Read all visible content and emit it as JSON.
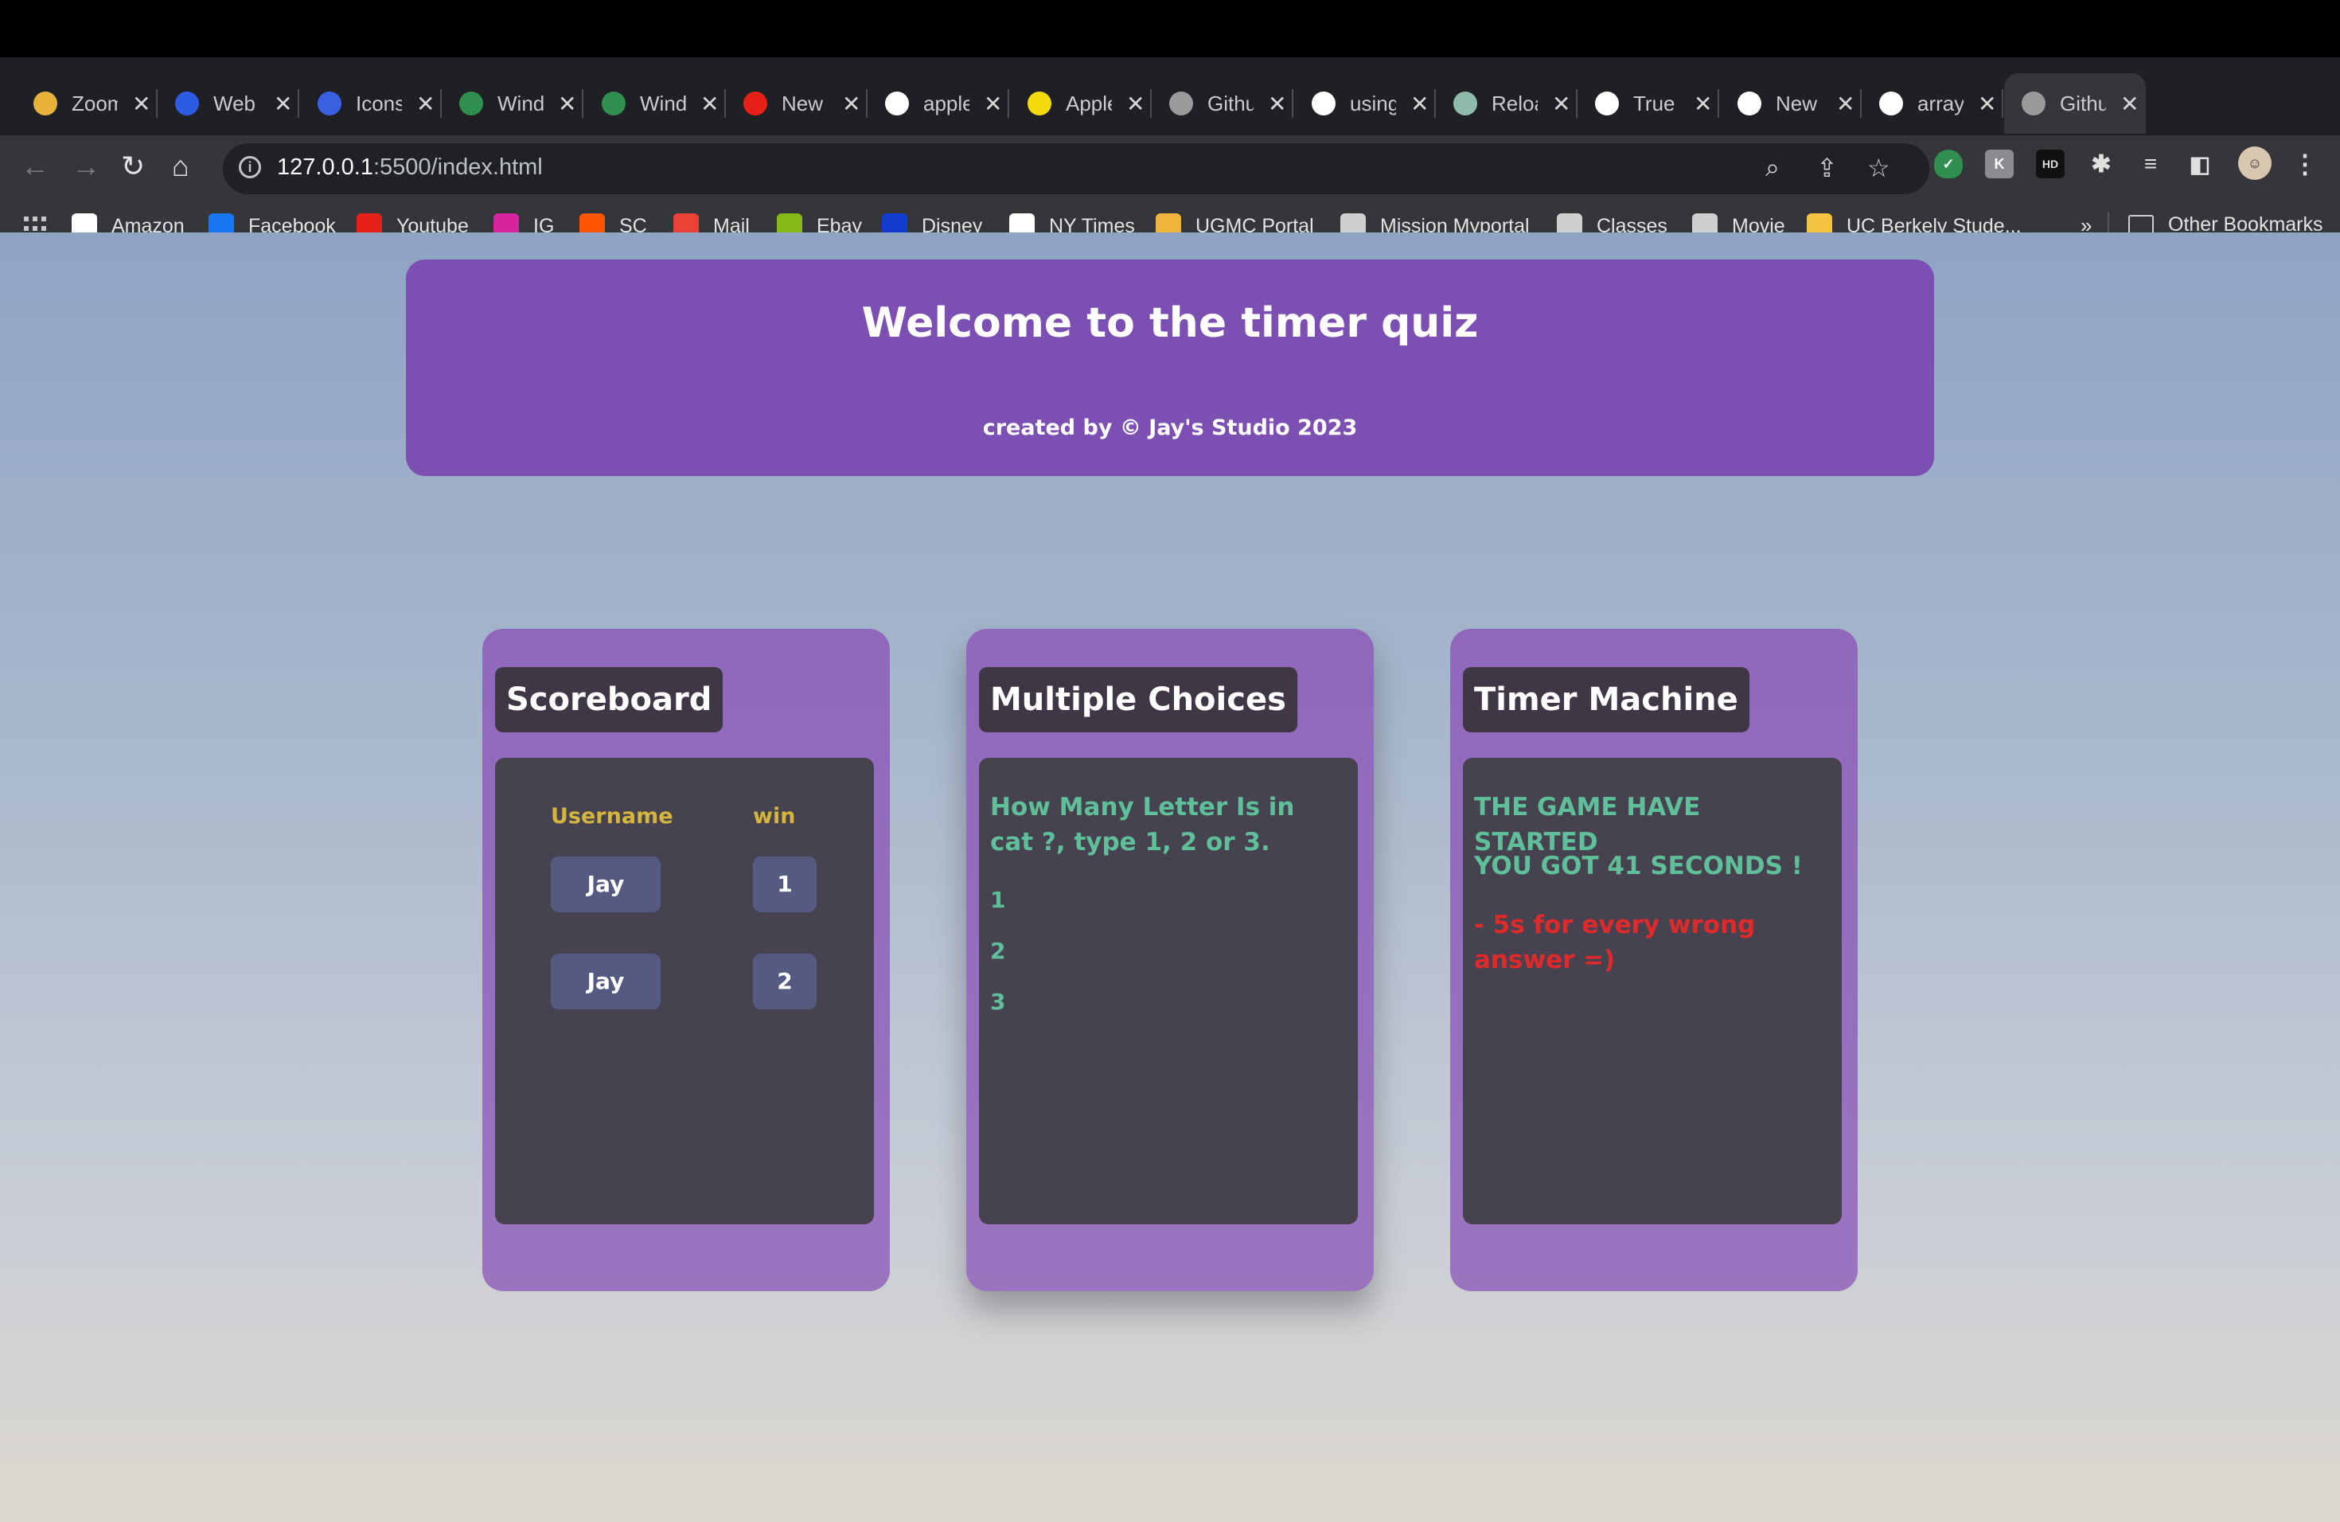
{
  "browser": {
    "tabs": [
      {
        "title": "Zoom",
        "icon": "zoom-icon",
        "color": "#e8b23a"
      },
      {
        "title": "Web",
        "icon": "z-icon",
        "color": "#2d5be3"
      },
      {
        "title": "Icons",
        "icon": "f-icon",
        "color": "#3a5fe0"
      },
      {
        "title": "Window",
        "icon": "w-icon",
        "color": "#2f8f4e"
      },
      {
        "title": "Window",
        "icon": "w-icon",
        "color": "#2f8f4e"
      },
      {
        "title": "New",
        "icon": "youtube-icon",
        "color": "#e62117"
      },
      {
        "title": "apple",
        "icon": "google-icon",
        "color": "#ffffff"
      },
      {
        "title": "Apple",
        "icon": "tag-icon",
        "color": "#f5d90a"
      },
      {
        "title": "Github",
        "icon": "globe-icon",
        "color": "#9a9a9a"
      },
      {
        "title": "using",
        "icon": "google-icon",
        "color": "#ffffff"
      },
      {
        "title": "Reload",
        "icon": "openai-icon",
        "color": "#8fb9a8"
      },
      {
        "title": "True",
        "icon": "github-icon",
        "color": "#ffffff"
      },
      {
        "title": "New",
        "icon": "chrome-icon",
        "color": "#ffffff"
      },
      {
        "title": "array",
        "icon": "google-icon",
        "color": "#ffffff"
      },
      {
        "title": "Github",
        "icon": "globe-icon",
        "color": "#9a9a9a"
      }
    ],
    "url_host": "127.0.0.1",
    "url_rest": ":5500/index.html",
    "bookmarks": [
      {
        "label": "Amazon",
        "icon": "amazon-icon",
        "color": "#ffffff"
      },
      {
        "label": "Facebook",
        "icon": "facebook-icon",
        "color": "#1877f2"
      },
      {
        "label": "Youtube",
        "icon": "youtube-icon",
        "color": "#e62117"
      },
      {
        "label": "IG",
        "icon": "instagram-icon",
        "color": "#d6249f"
      },
      {
        "label": "SC",
        "icon": "soundcloud-icon",
        "color": "#ff5500"
      },
      {
        "label": "Mail",
        "icon": "gmail-icon",
        "color": "#ea4335"
      },
      {
        "label": "Ebay",
        "icon": "ebay-icon",
        "color": "#86b817"
      },
      {
        "label": "Disney",
        "icon": "disney-icon",
        "color": "#113ccf"
      },
      {
        "label": "NY Times",
        "icon": "nytimes-icon",
        "color": "#ffffff"
      },
      {
        "label": "UGMC Portal",
        "icon": "ugmc-icon",
        "color": "#f0b43c"
      },
      {
        "label": "Mission Myportal",
        "icon": "globe-icon",
        "color": "#cfcfcf"
      },
      {
        "label": "Classes",
        "icon": "folder-icon",
        "color": "#cfcfcf"
      },
      {
        "label": "Movie",
        "icon": "globe-icon",
        "color": "#cfcfcf"
      },
      {
        "label": "UC  Berkely Stude...",
        "icon": "berkeley-icon",
        "color": "#f5c242"
      }
    ],
    "more_bookmarks": "»",
    "other_bookmarks": "Other Bookmarks"
  },
  "header": {
    "title": "Welcome to the timer quiz",
    "subtitle": "created by © Jay's Studio 2023"
  },
  "scoreboard": {
    "title": "Scoreboard",
    "col_username": "Username",
    "col_win": "win",
    "rows": [
      {
        "username": "Jay",
        "win": "1"
      },
      {
        "username": "Jay",
        "win": "2"
      }
    ]
  },
  "quiz": {
    "title": "Multiple Choices",
    "question": "How Many Letter Is in cat ?, type 1, 2 or 3.",
    "choices": [
      "1",
      "2",
      "3"
    ]
  },
  "timer": {
    "title": "Timer Machine",
    "status": "THE GAME HAVE STARTED",
    "countdown": "YOU GOT 41 SECONDS !",
    "penalty": "- 5s for every wrong answer =)",
    "colors": {
      "info": "#5fbf99",
      "warning": "#e02a2a"
    }
  }
}
